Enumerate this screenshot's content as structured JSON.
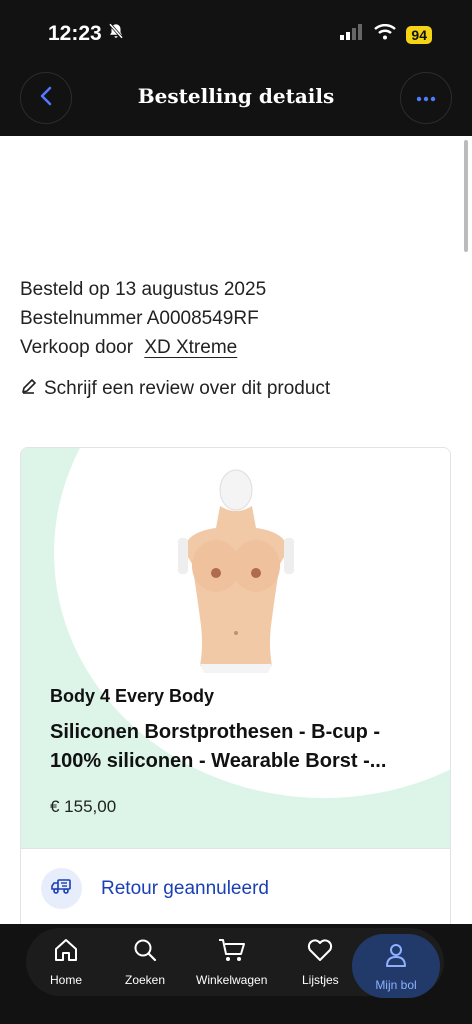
{
  "status_bar": {
    "time": "12:23",
    "battery": "94",
    "icons": [
      "bell-muted-icon",
      "signal-icon",
      "wifi-icon"
    ]
  },
  "header": {
    "title": "Bestelling details",
    "back_icon": "chevron-left-icon",
    "more_icon": "more-dots-icon"
  },
  "order": {
    "ordered_on": "Besteld op 13 augustus 2025",
    "order_number": "Bestelnummer A0008549RF",
    "sold_by_label": "Verkoop door",
    "seller": "XD Xtreme"
  },
  "review_link": "Schrijf een review over dit product",
  "product": {
    "brand": "Body 4 Every Body",
    "title": "Siliconen Borstprothesen - B-cup - 100% siliconen - Wearable Borst -...",
    "price": "€ 155,00",
    "return_status": "Retour geannuleerd"
  },
  "tabs": [
    {
      "label": "Home",
      "icon": "home-icon"
    },
    {
      "label": "Zoeken",
      "icon": "search-icon"
    },
    {
      "label": "Winkelwagen",
      "icon": "cart-icon"
    },
    {
      "label": "Lijstjes",
      "icon": "heart-icon"
    },
    {
      "label": "Mijn bol",
      "icon": "user-icon",
      "active": true
    }
  ],
  "colors": {
    "accent_blue": "#1a3fb6",
    "mint": "#dcf5e8",
    "dark": "#121212",
    "battery": "#f5d415"
  }
}
